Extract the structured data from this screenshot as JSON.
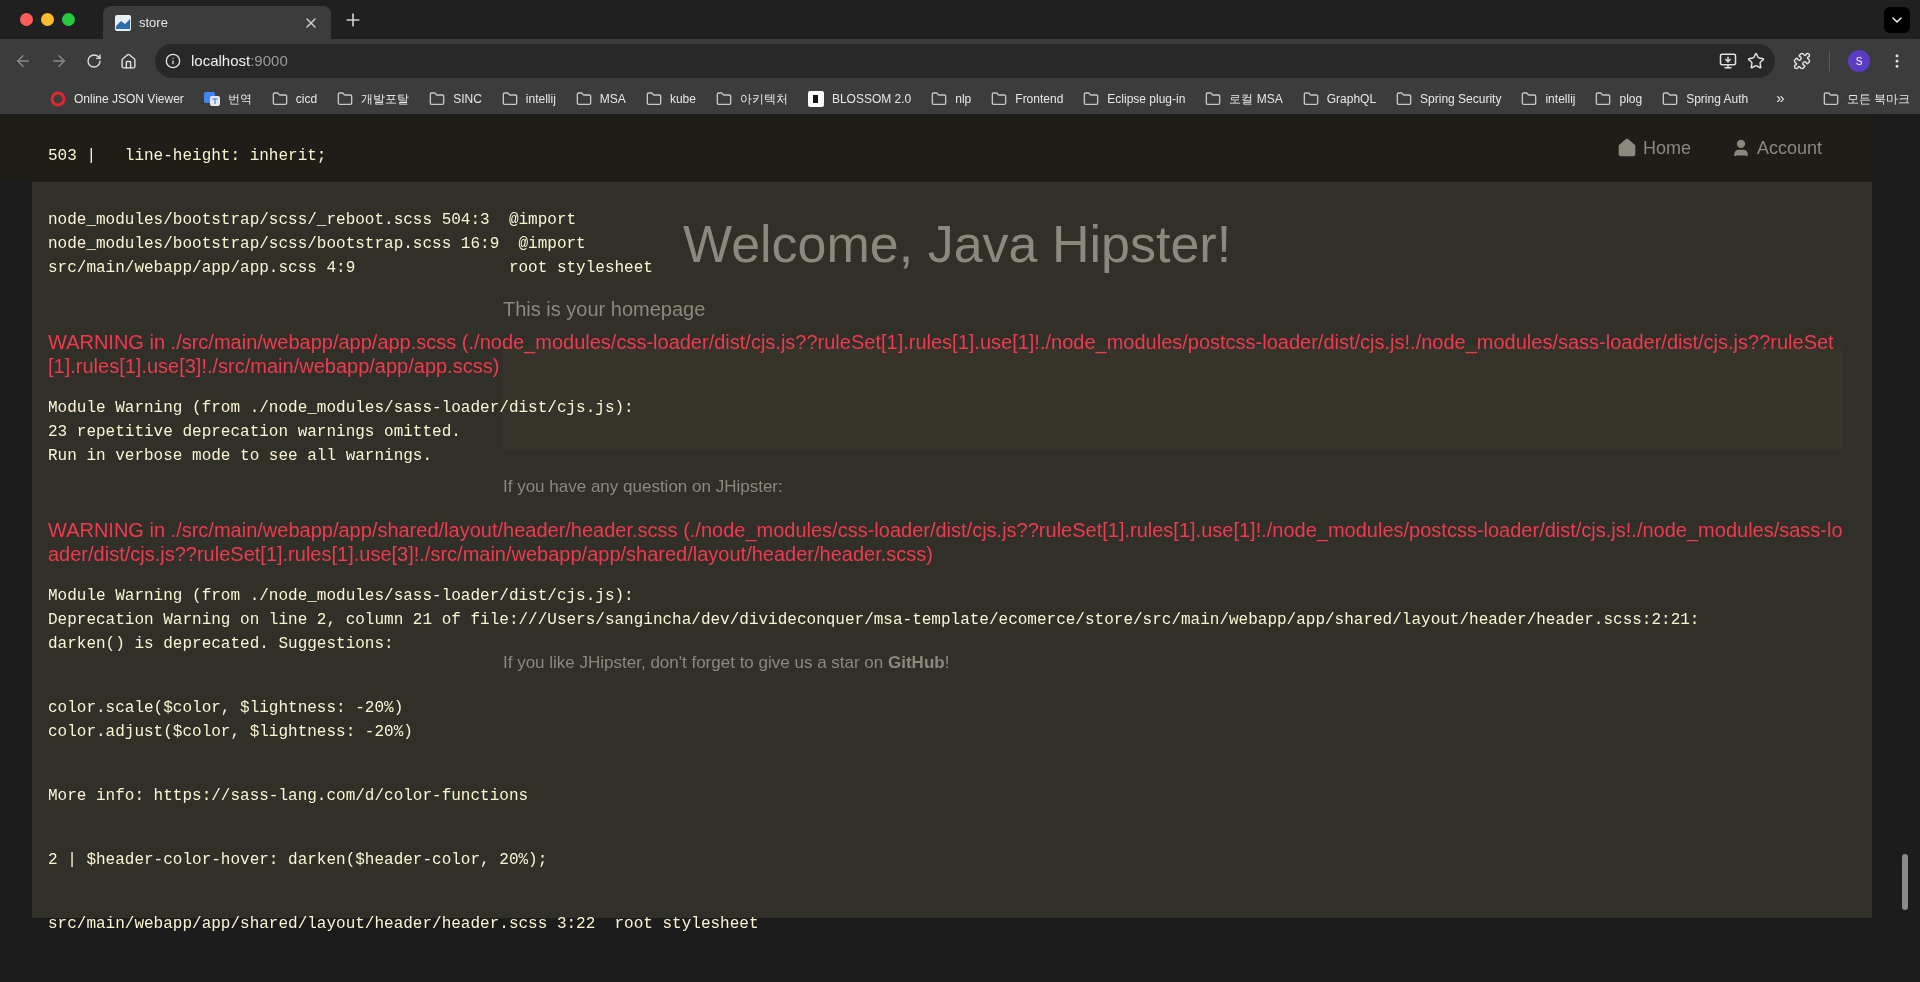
{
  "browser": {
    "tabs": [
      {
        "title": "store",
        "selected": true
      }
    ],
    "address": {
      "host": "localhost",
      "port": ":9000"
    },
    "profile_initial": "S",
    "bookmarks": [
      {
        "label": "Online JSON Viewer",
        "kind": "viewer"
      },
      {
        "label": "번역",
        "kind": "translate"
      },
      {
        "label": "cicd",
        "kind": "folder"
      },
      {
        "label": "개발포탈",
        "kind": "folder"
      },
      {
        "label": "SINC",
        "kind": "folder"
      },
      {
        "label": "intellij",
        "kind": "folder"
      },
      {
        "label": "MSA",
        "kind": "folder"
      },
      {
        "label": "kube",
        "kind": "folder"
      },
      {
        "label": "아키텍처",
        "kind": "folder"
      },
      {
        "label": "BLOSSOM 2.0",
        "kind": "site"
      },
      {
        "label": "nlp",
        "kind": "folder"
      },
      {
        "label": "Frontend",
        "kind": "folder"
      },
      {
        "label": "Eclipse plug-in",
        "kind": "folder"
      },
      {
        "label": "로컬 MSA",
        "kind": "folder"
      },
      {
        "label": "GraphQL",
        "kind": "folder"
      },
      {
        "label": "Spring Security",
        "kind": "folder"
      },
      {
        "label": "intellij",
        "kind": "folder"
      },
      {
        "label": "plog",
        "kind": "folder"
      },
      {
        "label": "Spring Auth",
        "kind": "folder"
      }
    ],
    "bookmarks_more": "»",
    "all_bookmarks": "모든 북마크"
  },
  "page": {
    "nav": [
      {
        "label": "Home",
        "kind": "home"
      },
      {
        "label": "Account",
        "kind": "account"
      }
    ],
    "heading": "Welcome, Java Hipster!",
    "subheading": "This is your homepage",
    "question": "If you have any question on JHipster:",
    "star_note": "If you like JHipster, don't forget to give us a star on **GitHub**!"
  },
  "overlay": {
    "blocks": [
      {
        "kind": "code",
        "lines": [
          "503 |   line-height: inherit;"
        ]
      },
      {
        "kind": "code",
        "lines": [
          "node_modules/bootstrap/scss/_reboot.scss 504:3  @import",
          "node_modules/bootstrap/scss/bootstrap.scss 16:9  @import",
          "src/main/webapp/app/app.scss 4:9                root stylesheet"
        ]
      },
      {
        "kind": "warning",
        "text": "WARNING in ./src/main/webapp/app/app.scss (./node_modules/css-loader/dist/cjs.js??ruleSet[1].rules[1].use[1]!./node_modules/postcss-loader/dist/cjs.js!./node_modules/sass-loader/dist/cjs.js??ruleSet[1].rules[1].use[3]!./src/main/webapp/app/app.scss)"
      },
      {
        "kind": "code",
        "lines": [
          "Module Warning (from ./node_modules/sass-loader/dist/cjs.js):",
          "23 repetitive deprecation warnings omitted.",
          "Run in verbose mode to see all warnings."
        ]
      },
      {
        "kind": "warning",
        "text": "WARNING in ./src/main/webapp/app/shared/layout/header/header.scss (./node_modules/css-loader/dist/cjs.js??ruleSet[1].rules[1].use[1]!./node_modules/postcss-loader/dist/cjs.js!./node_modules/sass-loader/dist/cjs.js??ruleSet[1].rules[1].use[3]!./src/main/webapp/app/shared/layout/header/header.scss)"
      },
      {
        "kind": "code",
        "lines": [
          "Module Warning (from ./node_modules/sass-loader/dist/cjs.js):",
          "Deprecation Warning on line 2, column 21 of file:///Users/sangincha/dev/divideconquer/msa-template/ecomerce/store/src/main/webapp/app/shared/layout/header/header.scss:2:21:",
          "darken() is deprecated. Suggestions:"
        ]
      },
      {
        "kind": "code",
        "lines": [
          "color.scale($color, $lightness: -20%)",
          "color.adjust($color, $lightness: -20%)"
        ]
      },
      {
        "kind": "code",
        "lines": [
          "More info: https://sass-lang.com/d/color-functions"
        ]
      },
      {
        "kind": "code",
        "lines": [
          "2 | $header-color-hover: darken($header-color, 20%);"
        ]
      },
      {
        "kind": "code",
        "lines": [
          "src/main/webapp/app/shared/layout/header/header.scss 3:22  root stylesheet"
        ]
      }
    ]
  }
}
